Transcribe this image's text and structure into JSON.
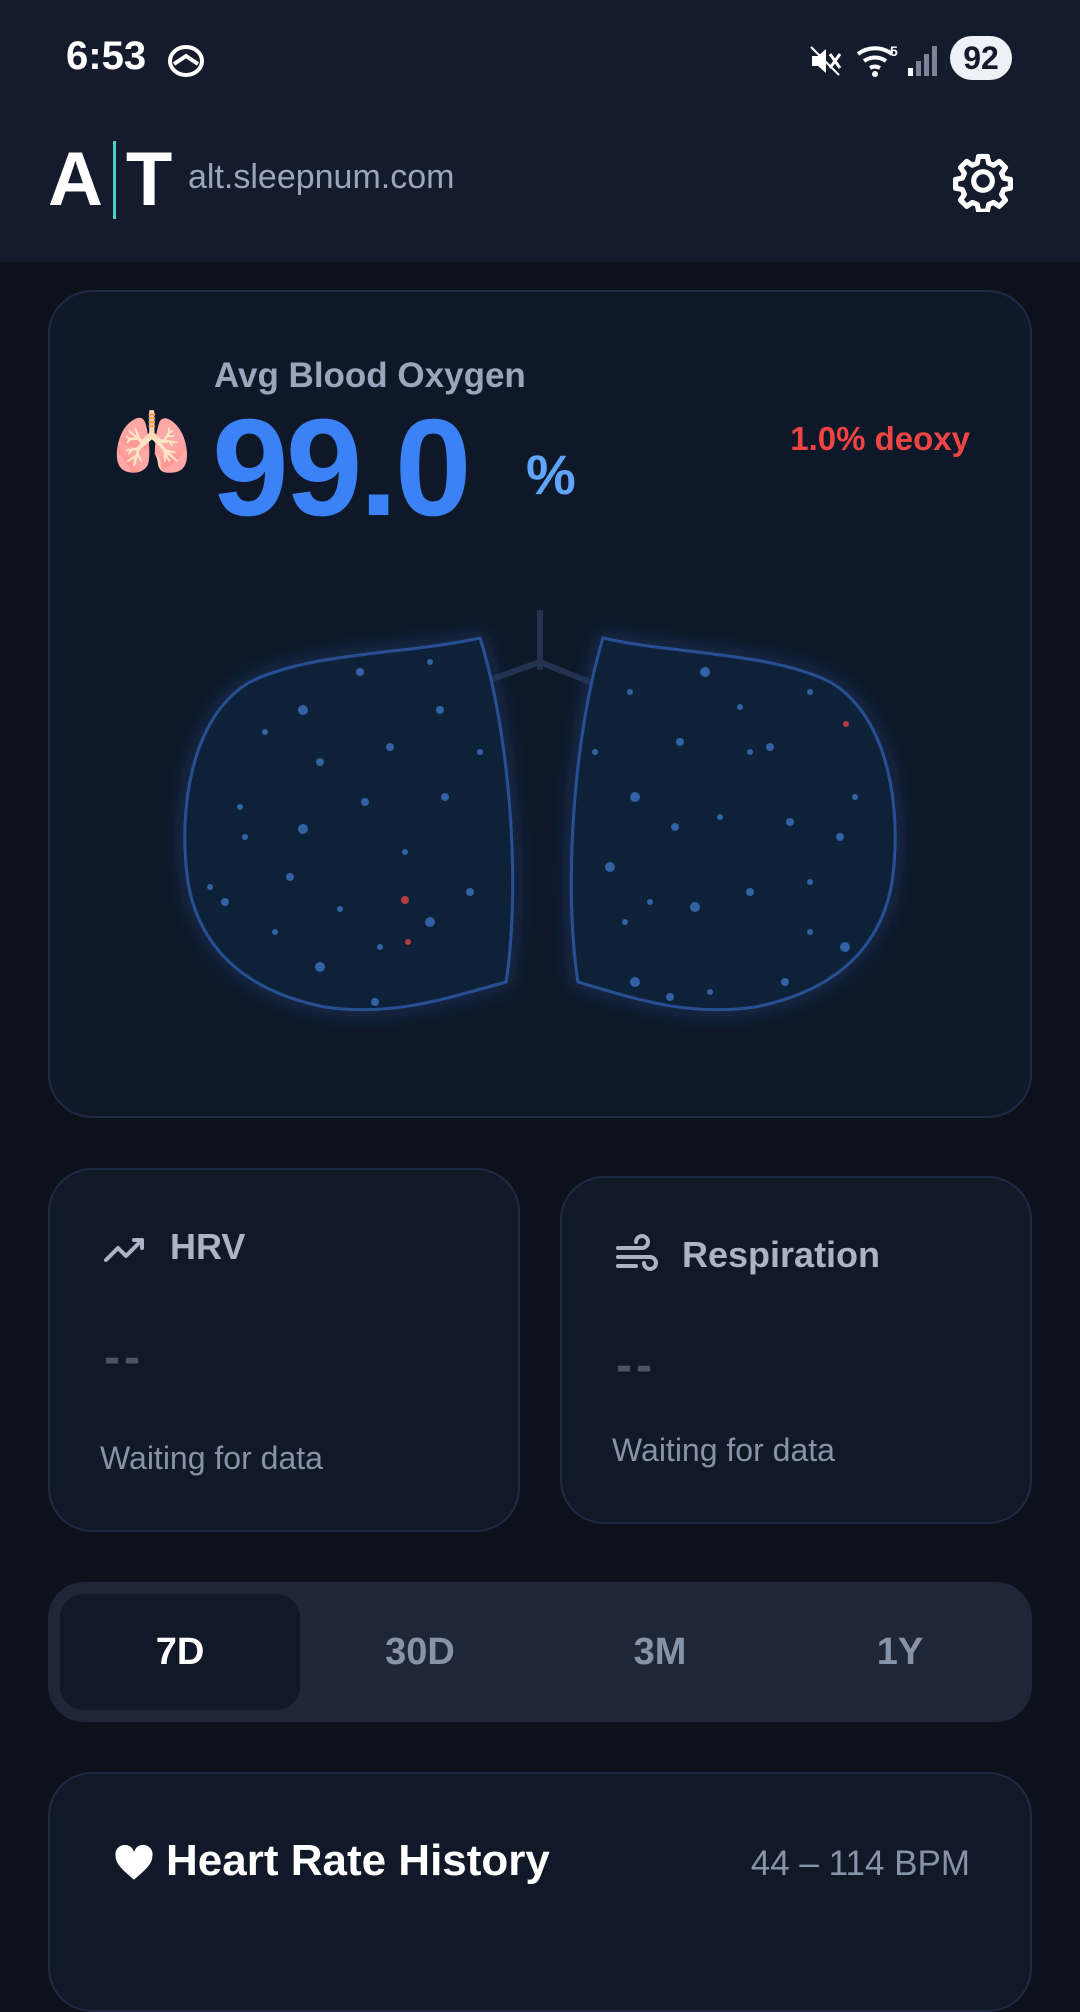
{
  "status": {
    "time": "6:53",
    "battery": "92",
    "network_label": "5",
    "icons": [
      "vpn-icon",
      "mute-icon",
      "wifi-icon",
      "signal-icon"
    ]
  },
  "header": {
    "logo_left": "A",
    "logo_right": "T",
    "domain": "alt.sleepnum.com",
    "settings_icon": "gear-icon"
  },
  "spo2": {
    "label": "Avg Blood Oxygen",
    "value": "99.0",
    "unit": "%",
    "deoxy": "1.0% deoxy",
    "icon": "lungs-emoji",
    "value_color": "#3b82f6",
    "deoxy_color": "#ef4444"
  },
  "hrv": {
    "title": "HRV",
    "value": "--",
    "note": "Waiting for data",
    "icon": "trend-line-icon"
  },
  "respiration": {
    "title": "Respiration",
    "value": "--",
    "note": "Waiting for data",
    "icon": "wind-icon"
  },
  "range": {
    "options": [
      "7D",
      "30D",
      "3M",
      "1Y"
    ],
    "selected": "7D"
  },
  "heart_rate": {
    "title": "Heart Rate History",
    "range": "44 – 114 BPM",
    "icon": "heart-icon"
  }
}
